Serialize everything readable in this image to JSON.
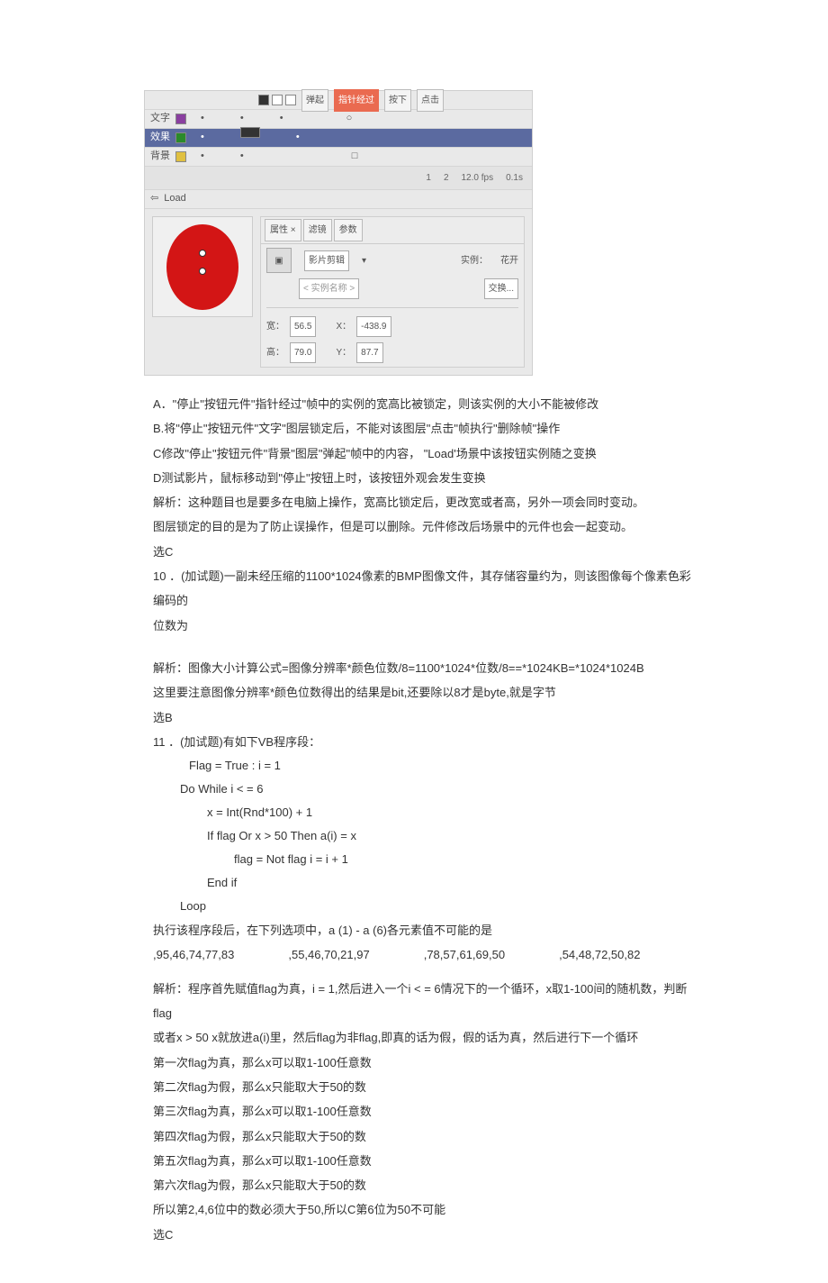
{
  "flash": {
    "header_tabs": [
      "弹起",
      "指针经过",
      "按下",
      "点击"
    ],
    "layers": [
      "文字",
      "效果",
      "背景"
    ],
    "tl_btn": "Load",
    "tl_frame": "1",
    "tl_total": "2",
    "tl_fps": "12.0 fps",
    "tl_time": "0.1s",
    "props": {
      "tabs": [
        "属性 ×",
        "滤镜",
        "参数"
      ],
      "type": "影片剪辑",
      "inst_label": "实例：",
      "inst_name": "花开",
      "name_field": "< 实例名称 >",
      "swap_btn": "交换...",
      "w_label": "宽：",
      "w": "56.5",
      "x_label": "X：",
      "x": "-438.9",
      "h_label": "高：",
      "h": "79.0",
      "y_label": "Y：",
      "y": "87.7"
    }
  },
  "q9": {
    "A": "A．\"停止\"按钮元件\"指针经过\"帧中的实例的宽高比被锁定，则该实例的大小不能被修改",
    "B": "B.将\"停止\"按钮元件\"文字\"图层锁定后，不能对该图层\"点击\"帧执行\"删除帧\"操作",
    "C": "C修改\"停止\"按钮元件\"背景\"图层\"弹起\"帧中的内容，     \"Load'场景中该按钮实例随之变换",
    "D": "D测试影片，鼠标移动到\"停止\"按钮上时，该按钮外观会发生变换",
    "a1": "解析：这种题目也是要多在电脑上操作，宽高比锁定后，更改宽或者高，另外一项会同时变动。",
    "a2": "图层锁定的目的是为了防止误操作，但是可以删除。元件修改后场景中的元件也会一起变动。",
    "ans": "选C"
  },
  "q10": {
    "stem1": "10 ．(加试题)一副未经压缩的1100*1024像素的BMP图像文件，其存储容量约为，则该图像每个像素色彩编码的",
    "stem2": "位数为",
    "a1": "解析：图像大小计算公式=图像分辨率*颜色位数/8=1100*1024*位数/8==*1024KB=*1024*1024B",
    "a2": "这里要注意图像分辨率*颜色位数得出的结果是bit,还要除以8才是byte,就是字节",
    "ans": "选B"
  },
  "q11": {
    "stem": "11 ．(加试题)有如下VB程序段：",
    "code": [
      "Flag = True : i = 1",
      "Do While i < = 6",
      "    x = Int(Rnd*100) + 1",
      "    If flag Or x > 50 Then a(i) = x",
      "         flag = Not flag i = i + 1",
      "    End if",
      "Loop"
    ],
    "after": "执行该程序段后，在下列选项中，a (1) - a (6)各元素值不可能的是",
    "opts": [
      ",95,46,74,77,83",
      ",55,46,70,21,97",
      ",78,57,61,69,50",
      ",54,48,72,50,82"
    ],
    "a1": "解析：程序首先赋值flag为真，i = 1,然后进入一个i < = 6情况下的一个循环，x取1-100间的随机数，判断flag",
    "a2": "或者x > 50 x就放进a(i)里，然后flag为非flag,即真的话为假，假的话为真，然后进行下一个循环",
    "l1": "第一次flag为真，那么x可以取1-100任意数",
    "l2": "第二次flag为假，那么x只能取大于50的数",
    "l3": "第三次flag为真，那么x可以取1-100任意数",
    "l4": "第四次flag为假，那么x只能取大于50的数",
    "l5": "第五次flag为真，那么x可以取1-100任意数",
    "l6": "第六次flag为假，那么x只能取大于50的数",
    "conc": "所以第2,4,6位中的数必须大于50,所以C第6位为50不可能",
    "ans": "选C"
  }
}
